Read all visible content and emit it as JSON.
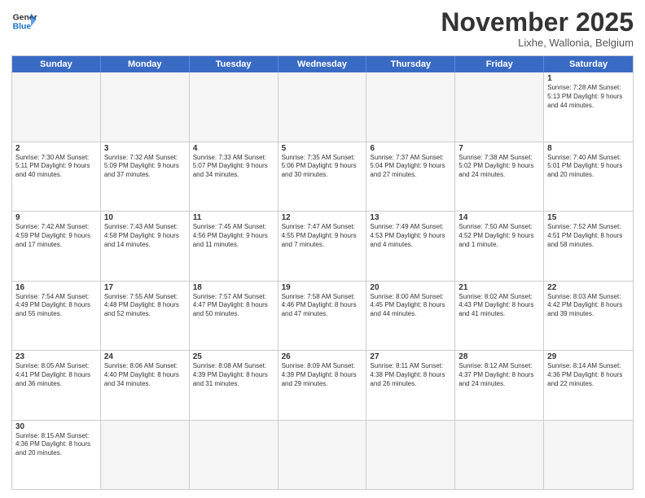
{
  "header": {
    "logo_general": "General",
    "logo_blue": "Blue",
    "title": "November 2025",
    "subtitle": "Lixhe, Wallonia, Belgium"
  },
  "days_of_week": [
    "Sunday",
    "Monday",
    "Tuesday",
    "Wednesday",
    "Thursday",
    "Friday",
    "Saturday"
  ],
  "weeks": [
    [
      {
        "day": "",
        "info": "",
        "empty": true
      },
      {
        "day": "",
        "info": "",
        "empty": true
      },
      {
        "day": "",
        "info": "",
        "empty": true
      },
      {
        "day": "",
        "info": "",
        "empty": true
      },
      {
        "day": "",
        "info": "",
        "empty": true
      },
      {
        "day": "",
        "info": "",
        "empty": true
      },
      {
        "day": "1",
        "info": "Sunrise: 7:28 AM\nSunset: 5:13 PM\nDaylight: 9 hours\nand 44 minutes."
      }
    ],
    [
      {
        "day": "2",
        "info": "Sunrise: 7:30 AM\nSunset: 5:11 PM\nDaylight: 9 hours\nand 40 minutes."
      },
      {
        "day": "3",
        "info": "Sunrise: 7:32 AM\nSunset: 5:09 PM\nDaylight: 9 hours\nand 37 minutes."
      },
      {
        "day": "4",
        "info": "Sunrise: 7:33 AM\nSunset: 5:07 PM\nDaylight: 9 hours\nand 34 minutes."
      },
      {
        "day": "5",
        "info": "Sunrise: 7:35 AM\nSunset: 5:06 PM\nDaylight: 9 hours\nand 30 minutes."
      },
      {
        "day": "6",
        "info": "Sunrise: 7:37 AM\nSunset: 5:04 PM\nDaylight: 9 hours\nand 27 minutes."
      },
      {
        "day": "7",
        "info": "Sunrise: 7:38 AM\nSunset: 5:02 PM\nDaylight: 9 hours\nand 24 minutes."
      },
      {
        "day": "8",
        "info": "Sunrise: 7:40 AM\nSunset: 5:01 PM\nDaylight: 9 hours\nand 20 minutes."
      }
    ],
    [
      {
        "day": "9",
        "info": "Sunrise: 7:42 AM\nSunset: 4:59 PM\nDaylight: 9 hours\nand 17 minutes."
      },
      {
        "day": "10",
        "info": "Sunrise: 7:43 AM\nSunset: 4:58 PM\nDaylight: 9 hours\nand 14 minutes."
      },
      {
        "day": "11",
        "info": "Sunrise: 7:45 AM\nSunset: 4:56 PM\nDaylight: 9 hours\nand 11 minutes."
      },
      {
        "day": "12",
        "info": "Sunrise: 7:47 AM\nSunset: 4:55 PM\nDaylight: 9 hours\nand 7 minutes."
      },
      {
        "day": "13",
        "info": "Sunrise: 7:49 AM\nSunset: 4:53 PM\nDaylight: 9 hours\nand 4 minutes."
      },
      {
        "day": "14",
        "info": "Sunrise: 7:50 AM\nSunset: 4:52 PM\nDaylight: 9 hours\nand 1 minute."
      },
      {
        "day": "15",
        "info": "Sunrise: 7:52 AM\nSunset: 4:51 PM\nDaylight: 8 hours\nand 58 minutes."
      }
    ],
    [
      {
        "day": "16",
        "info": "Sunrise: 7:54 AM\nSunset: 4:49 PM\nDaylight: 8 hours\nand 55 minutes."
      },
      {
        "day": "17",
        "info": "Sunrise: 7:55 AM\nSunset: 4:48 PM\nDaylight: 8 hours\nand 52 minutes."
      },
      {
        "day": "18",
        "info": "Sunrise: 7:57 AM\nSunset: 4:47 PM\nDaylight: 8 hours\nand 50 minutes."
      },
      {
        "day": "19",
        "info": "Sunrise: 7:58 AM\nSunset: 4:46 PM\nDaylight: 8 hours\nand 47 minutes."
      },
      {
        "day": "20",
        "info": "Sunrise: 8:00 AM\nSunset: 4:45 PM\nDaylight: 8 hours\nand 44 minutes."
      },
      {
        "day": "21",
        "info": "Sunrise: 8:02 AM\nSunset: 4:43 PM\nDaylight: 8 hours\nand 41 minutes."
      },
      {
        "day": "22",
        "info": "Sunrise: 8:03 AM\nSunset: 4:42 PM\nDaylight: 8 hours\nand 39 minutes."
      }
    ],
    [
      {
        "day": "23",
        "info": "Sunrise: 8:05 AM\nSunset: 4:41 PM\nDaylight: 8 hours\nand 36 minutes."
      },
      {
        "day": "24",
        "info": "Sunrise: 8:06 AM\nSunset: 4:40 PM\nDaylight: 8 hours\nand 34 minutes."
      },
      {
        "day": "25",
        "info": "Sunrise: 8:08 AM\nSunset: 4:39 PM\nDaylight: 8 hours\nand 31 minutes."
      },
      {
        "day": "26",
        "info": "Sunrise: 8:09 AM\nSunset: 4:39 PM\nDaylight: 8 hours\nand 29 minutes."
      },
      {
        "day": "27",
        "info": "Sunrise: 8:11 AM\nSunset: 4:38 PM\nDaylight: 8 hours\nand 26 minutes."
      },
      {
        "day": "28",
        "info": "Sunrise: 8:12 AM\nSunset: 4:37 PM\nDaylight: 8 hours\nand 24 minutes."
      },
      {
        "day": "29",
        "info": "Sunrise: 8:14 AM\nSunset: 4:36 PM\nDaylight: 8 hours\nand 22 minutes."
      }
    ],
    [
      {
        "day": "30",
        "info": "Sunrise: 8:15 AM\nSunset: 4:36 PM\nDaylight: 8 hours\nand 20 minutes."
      },
      {
        "day": "",
        "info": "",
        "empty": true
      },
      {
        "day": "",
        "info": "",
        "empty": true
      },
      {
        "day": "",
        "info": "",
        "empty": true
      },
      {
        "day": "",
        "info": "",
        "empty": true
      },
      {
        "day": "",
        "info": "",
        "empty": true
      },
      {
        "day": "",
        "info": "",
        "empty": true
      }
    ]
  ]
}
